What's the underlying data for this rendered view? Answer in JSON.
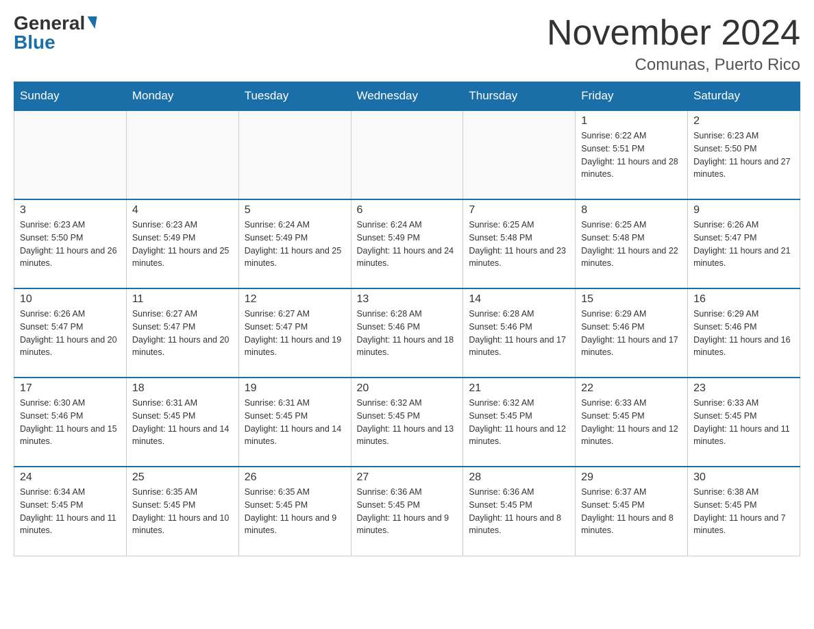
{
  "header": {
    "logo_general": "General",
    "logo_blue": "Blue",
    "month_year": "November 2024",
    "location": "Comunas, Puerto Rico"
  },
  "days_of_week": [
    "Sunday",
    "Monday",
    "Tuesday",
    "Wednesday",
    "Thursday",
    "Friday",
    "Saturday"
  ],
  "weeks": [
    [
      {
        "day": "",
        "info": ""
      },
      {
        "day": "",
        "info": ""
      },
      {
        "day": "",
        "info": ""
      },
      {
        "day": "",
        "info": ""
      },
      {
        "day": "",
        "info": ""
      },
      {
        "day": "1",
        "info": "Sunrise: 6:22 AM\nSunset: 5:51 PM\nDaylight: 11 hours and 28 minutes."
      },
      {
        "day": "2",
        "info": "Sunrise: 6:23 AM\nSunset: 5:50 PM\nDaylight: 11 hours and 27 minutes."
      }
    ],
    [
      {
        "day": "3",
        "info": "Sunrise: 6:23 AM\nSunset: 5:50 PM\nDaylight: 11 hours and 26 minutes."
      },
      {
        "day": "4",
        "info": "Sunrise: 6:23 AM\nSunset: 5:49 PM\nDaylight: 11 hours and 25 minutes."
      },
      {
        "day": "5",
        "info": "Sunrise: 6:24 AM\nSunset: 5:49 PM\nDaylight: 11 hours and 25 minutes."
      },
      {
        "day": "6",
        "info": "Sunrise: 6:24 AM\nSunset: 5:49 PM\nDaylight: 11 hours and 24 minutes."
      },
      {
        "day": "7",
        "info": "Sunrise: 6:25 AM\nSunset: 5:48 PM\nDaylight: 11 hours and 23 minutes."
      },
      {
        "day": "8",
        "info": "Sunrise: 6:25 AM\nSunset: 5:48 PM\nDaylight: 11 hours and 22 minutes."
      },
      {
        "day": "9",
        "info": "Sunrise: 6:26 AM\nSunset: 5:47 PM\nDaylight: 11 hours and 21 minutes."
      }
    ],
    [
      {
        "day": "10",
        "info": "Sunrise: 6:26 AM\nSunset: 5:47 PM\nDaylight: 11 hours and 20 minutes."
      },
      {
        "day": "11",
        "info": "Sunrise: 6:27 AM\nSunset: 5:47 PM\nDaylight: 11 hours and 20 minutes."
      },
      {
        "day": "12",
        "info": "Sunrise: 6:27 AM\nSunset: 5:47 PM\nDaylight: 11 hours and 19 minutes."
      },
      {
        "day": "13",
        "info": "Sunrise: 6:28 AM\nSunset: 5:46 PM\nDaylight: 11 hours and 18 minutes."
      },
      {
        "day": "14",
        "info": "Sunrise: 6:28 AM\nSunset: 5:46 PM\nDaylight: 11 hours and 17 minutes."
      },
      {
        "day": "15",
        "info": "Sunrise: 6:29 AM\nSunset: 5:46 PM\nDaylight: 11 hours and 17 minutes."
      },
      {
        "day": "16",
        "info": "Sunrise: 6:29 AM\nSunset: 5:46 PM\nDaylight: 11 hours and 16 minutes."
      }
    ],
    [
      {
        "day": "17",
        "info": "Sunrise: 6:30 AM\nSunset: 5:46 PM\nDaylight: 11 hours and 15 minutes."
      },
      {
        "day": "18",
        "info": "Sunrise: 6:31 AM\nSunset: 5:45 PM\nDaylight: 11 hours and 14 minutes."
      },
      {
        "day": "19",
        "info": "Sunrise: 6:31 AM\nSunset: 5:45 PM\nDaylight: 11 hours and 14 minutes."
      },
      {
        "day": "20",
        "info": "Sunrise: 6:32 AM\nSunset: 5:45 PM\nDaylight: 11 hours and 13 minutes."
      },
      {
        "day": "21",
        "info": "Sunrise: 6:32 AM\nSunset: 5:45 PM\nDaylight: 11 hours and 12 minutes."
      },
      {
        "day": "22",
        "info": "Sunrise: 6:33 AM\nSunset: 5:45 PM\nDaylight: 11 hours and 12 minutes."
      },
      {
        "day": "23",
        "info": "Sunrise: 6:33 AM\nSunset: 5:45 PM\nDaylight: 11 hours and 11 minutes."
      }
    ],
    [
      {
        "day": "24",
        "info": "Sunrise: 6:34 AM\nSunset: 5:45 PM\nDaylight: 11 hours and 11 minutes."
      },
      {
        "day": "25",
        "info": "Sunrise: 6:35 AM\nSunset: 5:45 PM\nDaylight: 11 hours and 10 minutes."
      },
      {
        "day": "26",
        "info": "Sunrise: 6:35 AM\nSunset: 5:45 PM\nDaylight: 11 hours and 9 minutes."
      },
      {
        "day": "27",
        "info": "Sunrise: 6:36 AM\nSunset: 5:45 PM\nDaylight: 11 hours and 9 minutes."
      },
      {
        "day": "28",
        "info": "Sunrise: 6:36 AM\nSunset: 5:45 PM\nDaylight: 11 hours and 8 minutes."
      },
      {
        "day": "29",
        "info": "Sunrise: 6:37 AM\nSunset: 5:45 PM\nDaylight: 11 hours and 8 minutes."
      },
      {
        "day": "30",
        "info": "Sunrise: 6:38 AM\nSunset: 5:45 PM\nDaylight: 11 hours and 7 minutes."
      }
    ]
  ]
}
